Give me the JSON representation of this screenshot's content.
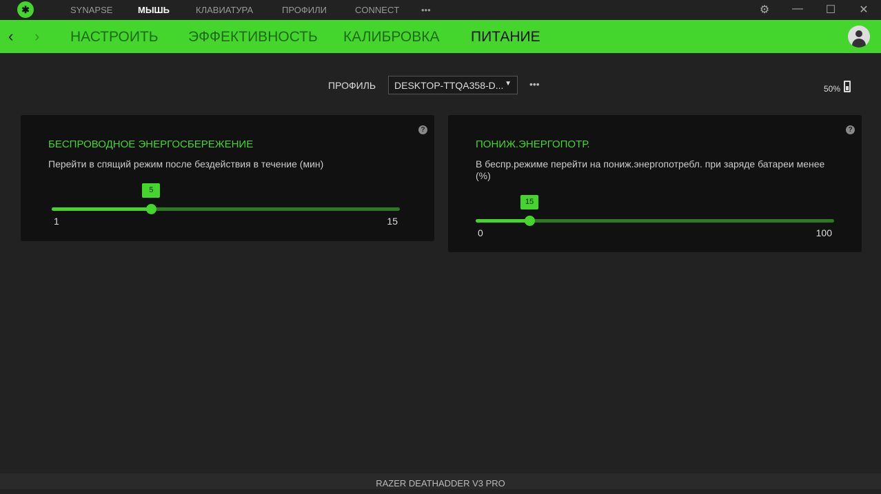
{
  "top_nav": {
    "items": [
      "SYNAPSE",
      "МЫШЬ",
      "КЛАВИАТУРА",
      "ПРОФИЛИ",
      "CONNECT"
    ],
    "more": "•••",
    "active": 1
  },
  "sub_nav": {
    "items": [
      "НАСТРОИТЬ",
      "ЭФФЕКТИВНОСТЬ",
      "КАЛИБРОВКА",
      "ПИТАНИЕ"
    ],
    "active": 3
  },
  "profile": {
    "label": "ПРОФИЛЬ",
    "value": "DESKTOP-TTQA358-D...",
    "more": "•••"
  },
  "battery": {
    "text": "50%",
    "level": 50
  },
  "cards": [
    {
      "title": "БЕСПРОВОДНОЕ ЭНЕРГОСБЕРЕЖЕНИЕ",
      "desc": "Перейти в спящий режим после бездействия в течение (мин)",
      "min": 1,
      "max": 15,
      "value": 5,
      "min_label": "1",
      "max_label": "15",
      "value_label": "5",
      "help": "?"
    },
    {
      "title": "ПОНИЖ.ЭНЕРГОПОТР.",
      "desc": "В беспр.режиме перейти на пониж.энергопотребл. при заряде батареи менее (%)",
      "min": 0,
      "max": 100,
      "value": 15,
      "min_label": "0",
      "max_label": "100",
      "value_label": "15",
      "help": "?"
    }
  ],
  "footer": "RAZER DEATHADDER V3 PRO",
  "colors": {
    "accent": "#44d62c",
    "bg": "#222222",
    "card": "#111111"
  }
}
